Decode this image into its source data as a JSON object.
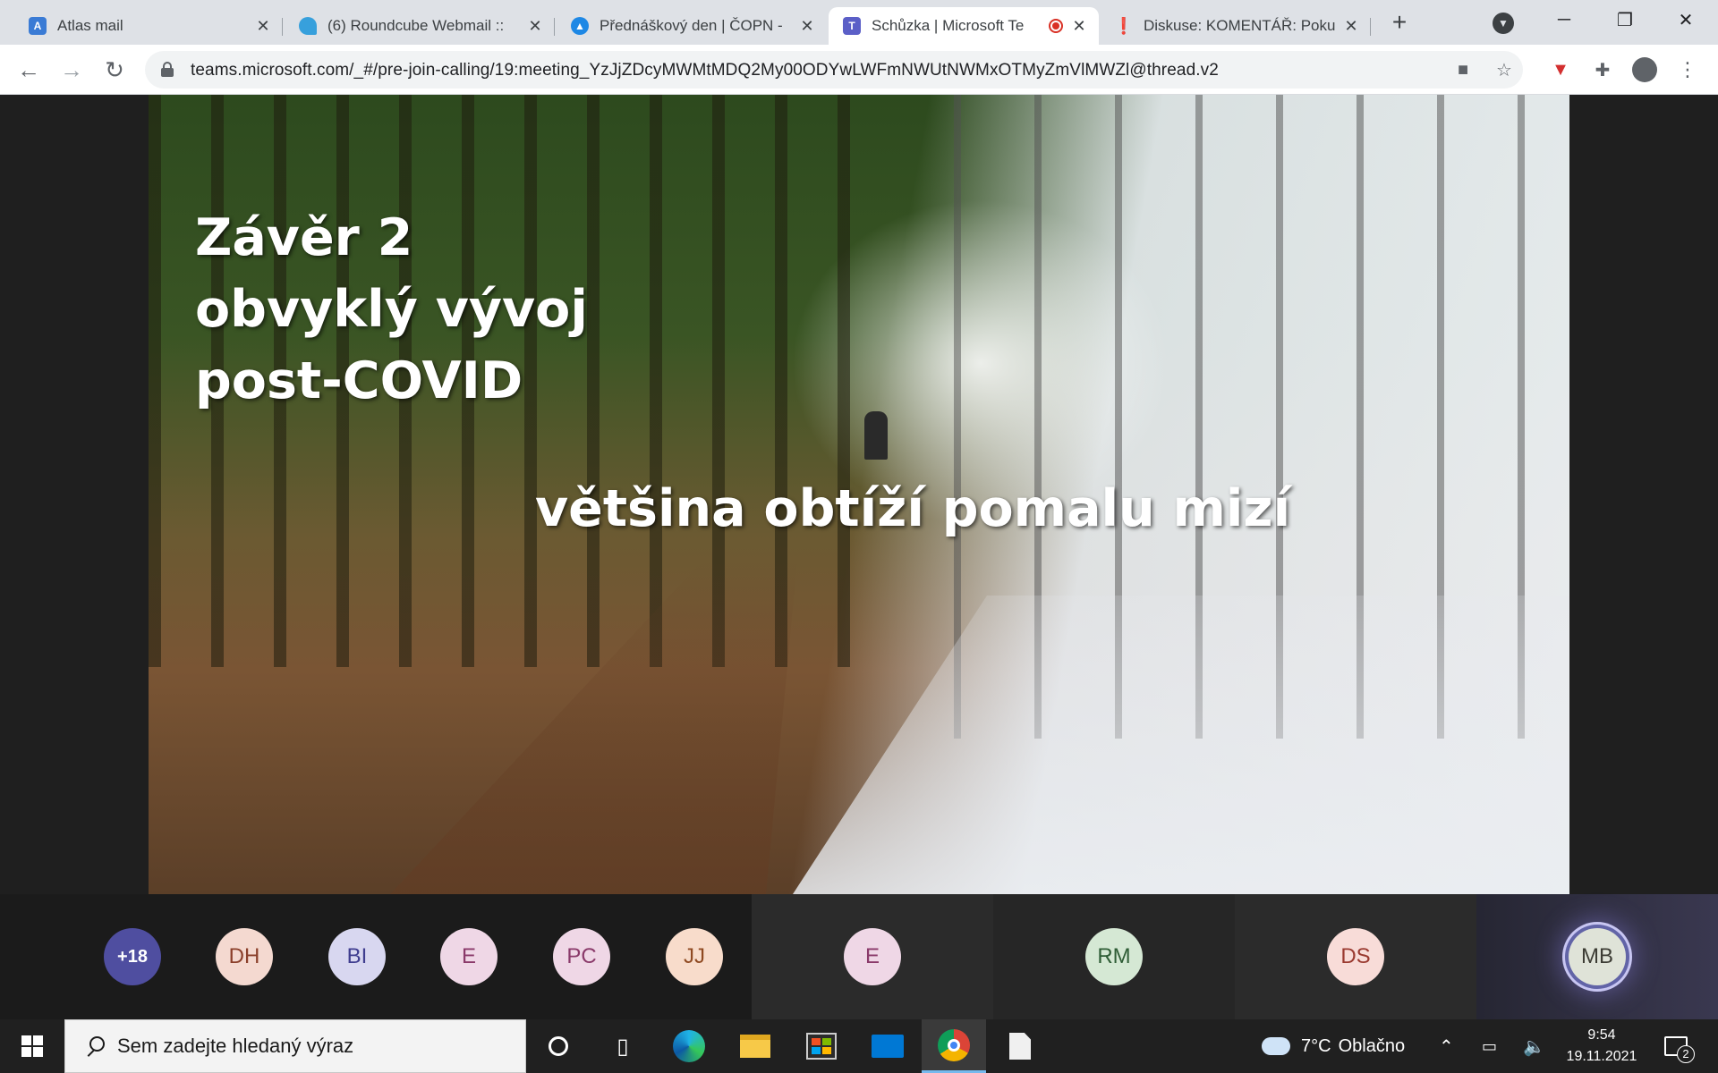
{
  "browser": {
    "tabs": [
      {
        "title": "Atlas mail",
        "favicon_color": "#3a7bd5"
      },
      {
        "title": "(6) Roundcube Webmail ::",
        "favicon_color": "#37a0dc"
      },
      {
        "title": "Přednáškový den | ČOPN -",
        "favicon_color": "#1e88e5"
      },
      {
        "title": "Schůzka | Microsoft Te",
        "favicon_color": "#5b5fc7",
        "recording": true
      },
      {
        "title": "Diskuse: KOMENTÁŘ: Poku",
        "favicon_color": "#e53935"
      }
    ],
    "url": "teams.microsoft.com/_#/pre-join-calling/19:meeting_YzJjZDcyMWMtMDQ2My00ODYwLWFmNWUtNWMxOTMyZmVlMWZl@thread.v2"
  },
  "slide": {
    "title_lines": [
      "Závěr 2",
      "obvyklý vývoj",
      "post-COVID"
    ],
    "subtitle": "většina obtíží pomalu mizí"
  },
  "participants": {
    "overflow_label": "+18",
    "people": [
      {
        "initials": "DH",
        "bg": "#f4d9d0",
        "fg": "#8a3f2a"
      },
      {
        "initials": "BI",
        "bg": "#d8d7f0",
        "fg": "#3f3d8f"
      },
      {
        "initials": "E",
        "bg": "#efd7e6",
        "fg": "#8a3a6a"
      },
      {
        "initials": "PC",
        "bg": "#efd7e6",
        "fg": "#8a3a6a"
      },
      {
        "initials": "JJ",
        "bg": "#f8dccb",
        "fg": "#8f4a22"
      },
      {
        "initials": "E",
        "bg": "#efd7e6",
        "fg": "#8a3a6a"
      },
      {
        "initials": "RM",
        "bg": "#d5e8d4",
        "fg": "#2f5d36"
      },
      {
        "initials": "DS",
        "bg": "#f8dcd8",
        "fg": "#9a3a30"
      },
      {
        "initials": "MB",
        "bg": "#dfe3d8",
        "fg": "#3c3c34"
      }
    ]
  },
  "taskbar": {
    "search_placeholder": "Sem zadejte hledaný výraz",
    "weather_temp": "7°C",
    "weather_text": "Oblačno",
    "time": "9:54",
    "date": "19.11.2021",
    "notification_count": "2"
  }
}
